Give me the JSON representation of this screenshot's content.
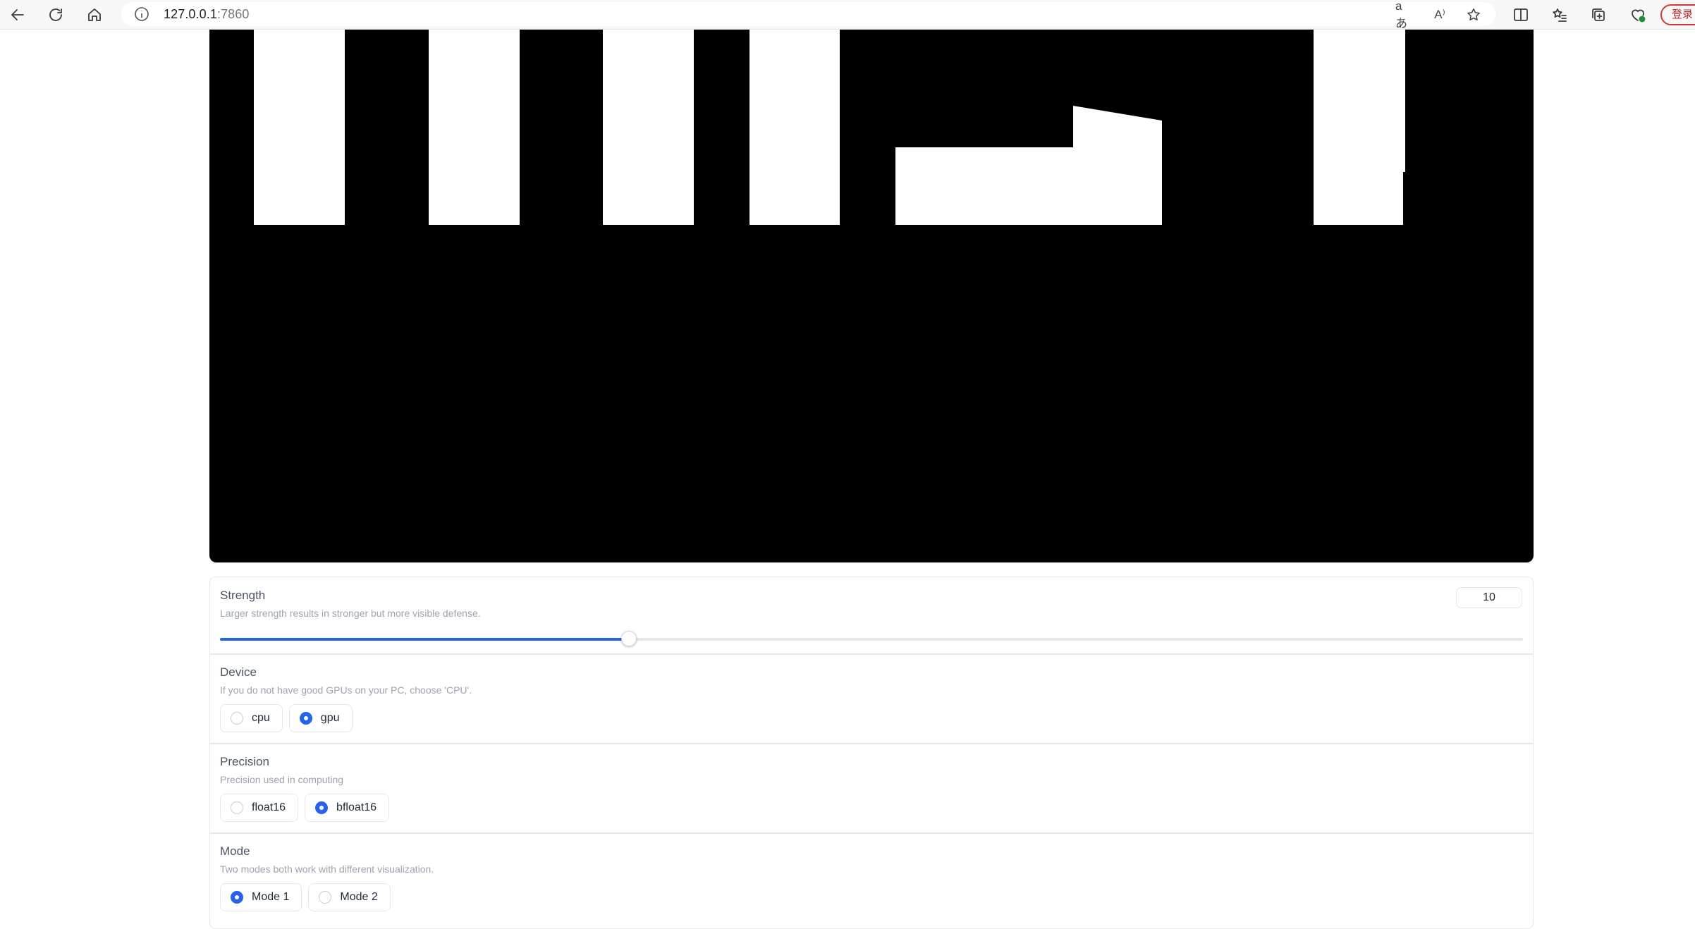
{
  "browser": {
    "url_host": "127.0.0.1",
    "url_port": ":7860",
    "login_label": "登录",
    "translate_glyph": "aあ",
    "read_aloud_glyph": "A⁾"
  },
  "strength": {
    "label": "Strength",
    "info": "Larger strength results in stronger but more visible defense.",
    "value": "10",
    "slider_fraction": 0.314
  },
  "device": {
    "label": "Device",
    "info": "If you do not have good GPUs on your PC, choose 'CPU'.",
    "options": [
      {
        "label": "cpu",
        "selected": false
      },
      {
        "label": "gpu",
        "selected": true
      }
    ]
  },
  "precision": {
    "label": "Precision",
    "info": "Precision used in computing",
    "options": [
      {
        "label": "float16",
        "selected": false
      },
      {
        "label": "bfloat16",
        "selected": true
      }
    ]
  },
  "mode": {
    "label": "Mode",
    "info": "Two modes both work with different visualization.",
    "options": [
      {
        "label": "Mode 1",
        "selected": true
      },
      {
        "label": "Mode 2",
        "selected": false
      }
    ]
  },
  "colors": {
    "accent": "#2563eb",
    "mask_background": "#000000",
    "mask_foreground": "#ffffff"
  }
}
